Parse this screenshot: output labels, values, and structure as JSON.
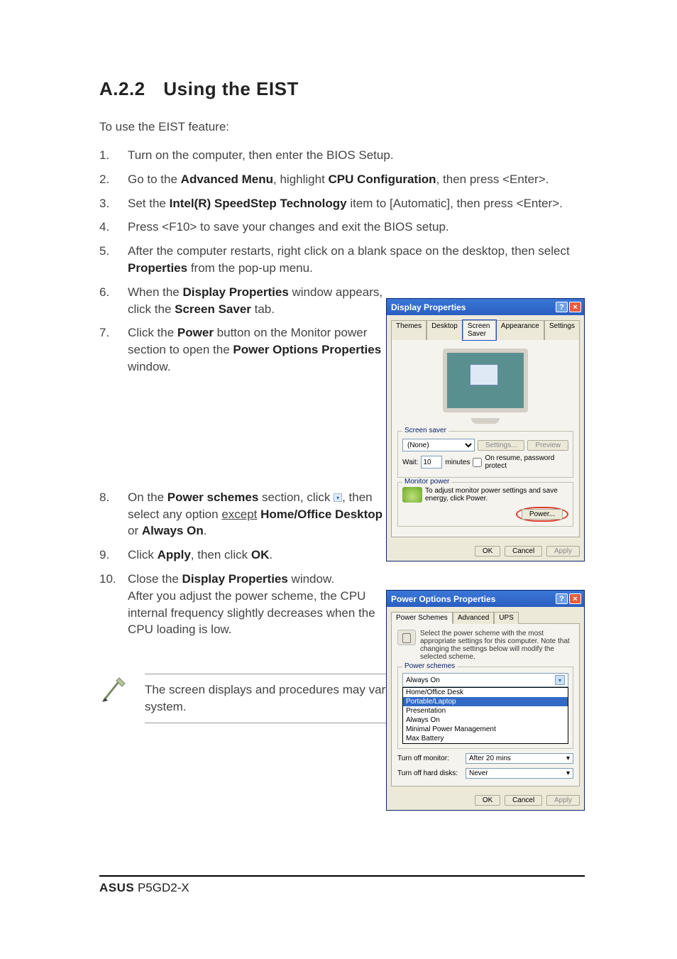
{
  "heading": {
    "number": "A.2.2",
    "title": "Using the EIST"
  },
  "intro": "To use the EIST feature:",
  "steps": {
    "s1": "Turn on the computer, then enter the BIOS Setup.",
    "s2a": "Go to the ",
    "s2b": "Advanced Menu",
    "s2c": ", highlight ",
    "s2d": "CPU Configuration",
    "s2e": ", then press <Enter>.",
    "s3a": "Set the ",
    "s3b": "Intel(R) SpeedStep Technology",
    "s3c": " item to [Automatic], then press <Enter>.",
    "s4": "Press <F10> to save your changes and exit the BIOS setup.",
    "s5a": "After the computer restarts, right click on a blank space on the desktop, then select ",
    "s5b": "Properties",
    "s5c": " from the pop-up menu.",
    "s6a": "When the ",
    "s6b": "Display Properties",
    "s6c": " window appears, click the ",
    "s6d": "Screen Saver",
    "s6e": " tab.",
    "s7a": "Click the ",
    "s7b": "Power",
    "s7c": " button on the Monitor power section to open the ",
    "s7d": "Power Options Properties",
    "s7e": " window.",
    "s8a": "On the ",
    "s8b": "Power schemes",
    "s8c": " section, click ",
    "s8d": ", then select any option ",
    "s8e": "except",
    "s8f": "Home/Office Desktop",
    "s8g": " or ",
    "s8h": "Always On",
    "s8i": ".",
    "s9a": "Click ",
    "s9b": "Apply",
    "s9c": ", then click ",
    "s9d": "OK",
    "s9e": ".",
    "s10a": "Close the ",
    "s10b": "Display Properties",
    "s10c": " window.",
    "s10d": "After you adjust the power scheme, the CPU internal frequency slightly decreases when the CPU loading is low."
  },
  "display_props": {
    "title": "Display Properties",
    "tabs": {
      "themes": "Themes",
      "desktop": "Desktop",
      "screen_saver": "Screen Saver",
      "appearance": "Appearance",
      "settings": "Settings"
    },
    "screensaver_group": "Screen saver",
    "screensaver_value": "(None)",
    "settings_btn": "Settings...",
    "preview_btn": "Preview",
    "wait_label": "Wait:",
    "wait_value": "10",
    "wait_unit": "minutes",
    "resume_label": "On resume, password protect",
    "monitor_group": "Monitor power",
    "monitor_text": "To adjust monitor power settings and save energy, click Power.",
    "power_btn": "Power...",
    "ok": "OK",
    "cancel": "Cancel",
    "apply": "Apply"
  },
  "power_opts": {
    "title": "Power Options Properties",
    "tabs": {
      "schemes": "Power Schemes",
      "advanced": "Advanced",
      "ups": "UPS"
    },
    "desc": "Select the power scheme with the most appropriate settings for this computer. Note that changing the settings below will modify the selected scheme.",
    "schemes_group": "Power schemes",
    "current": "Always On",
    "options": [
      "Home/Office Desk",
      "Portable/Laptop",
      "Presentation",
      "Always On",
      "Minimal Power Management",
      "Max Battery"
    ],
    "turn_off_monitor_label": "Turn off monitor:",
    "turn_off_monitor_value": "After 20 mins",
    "turn_off_disks_label": "Turn off hard disks:",
    "turn_off_disks_value": "Never",
    "ok": "OK",
    "cancel": "Cancel",
    "apply": "Apply"
  },
  "note": "The screen displays and procedures may vary depending on the operating system.",
  "footer": {
    "brand": "ASUS",
    "model": "P5GD2-X"
  }
}
